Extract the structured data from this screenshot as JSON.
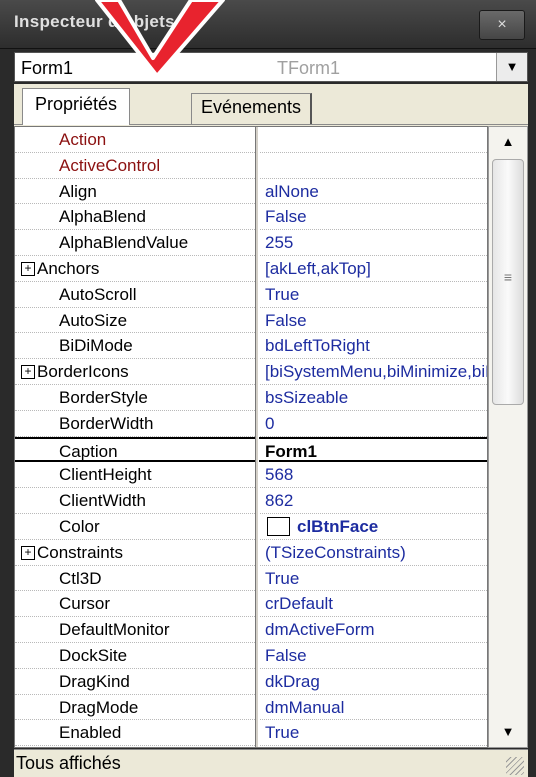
{
  "window": {
    "title": "Inspecteur d'objets",
    "close_glyph": "×"
  },
  "selector": {
    "object_name": "Form1",
    "object_type": "TForm1",
    "dropdown_glyph": "▼"
  },
  "tabs": [
    {
      "label": "Propriétés"
    },
    {
      "label": "Evénements"
    }
  ],
  "properties": [
    {
      "name": "Action",
      "value": "",
      "style": "red"
    },
    {
      "name": "ActiveControl",
      "value": "",
      "style": "red"
    },
    {
      "name": "Align",
      "value": "alNone"
    },
    {
      "name": "AlphaBlend",
      "value": "False"
    },
    {
      "name": "AlphaBlendValue",
      "value": "255"
    },
    {
      "name": "Anchors",
      "value": "[akLeft,akTop]",
      "expandable": true
    },
    {
      "name": "AutoScroll",
      "value": "True"
    },
    {
      "name": "AutoSize",
      "value": "False"
    },
    {
      "name": "BiDiMode",
      "value": "bdLeftToRight"
    },
    {
      "name": "BorderIcons",
      "value": "[biSystemMenu,biMinimize,biMaximize]",
      "expandable": true
    },
    {
      "name": "BorderStyle",
      "value": "bsSizeable"
    },
    {
      "name": "BorderWidth",
      "value": "0"
    },
    {
      "name": "Caption",
      "value": "Form1",
      "selected": true
    },
    {
      "name": "ClientHeight",
      "value": "568"
    },
    {
      "name": "ClientWidth",
      "value": "862"
    },
    {
      "name": "Color",
      "value": "clBtnFace",
      "swatch": "#ffffff",
      "bold": true
    },
    {
      "name": "Constraints",
      "value": "(TSizeConstraints)",
      "expandable": true
    },
    {
      "name": "Ctl3D",
      "value": "True"
    },
    {
      "name": "Cursor",
      "value": "crDefault"
    },
    {
      "name": "DefaultMonitor",
      "value": "dmActiveForm"
    },
    {
      "name": "DockSite",
      "value": "False"
    },
    {
      "name": "DragKind",
      "value": "dkDrag"
    },
    {
      "name": "DragMode",
      "value": "dmManual"
    },
    {
      "name": "Enabled",
      "value": "True"
    }
  ],
  "expand_glyph": "+",
  "scrollbar": {
    "up_glyph": "▲",
    "down_glyph": "▼",
    "grip_glyph": "≡"
  },
  "status": {
    "text": "Tous affichés"
  },
  "colors": {
    "property_link": "#1d2ca0",
    "event_red": "#8b1010",
    "panel": "#ece9d8",
    "annotation_arrow": "#e8232e"
  }
}
